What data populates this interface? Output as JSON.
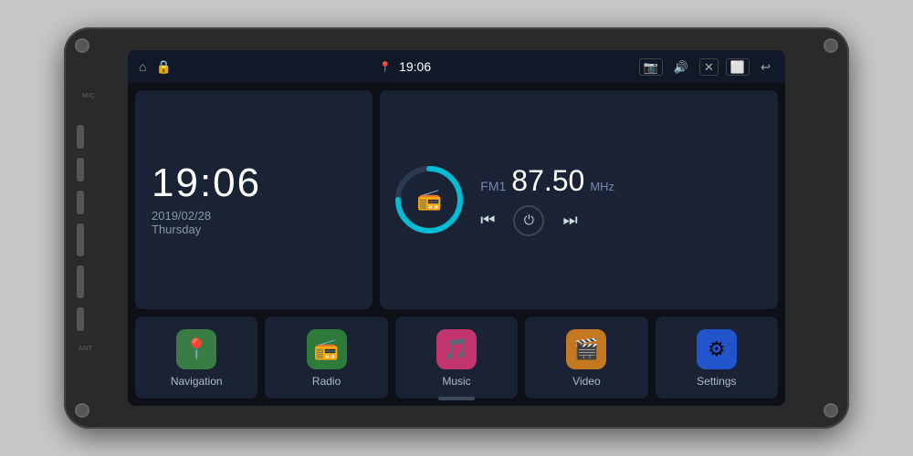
{
  "unit": {
    "background_color": "#2a2a2a"
  },
  "status_bar": {
    "time": "19:06",
    "location_icon": "📍",
    "home_icon": "⌂",
    "lock_icon": "🔒",
    "camera_icon": "📷",
    "volume_icon": "🔊",
    "mute_icon": "✕",
    "window_icon": "⬜",
    "back_icon": "↩"
  },
  "clock": {
    "time": "19:06",
    "date": "2019/02/28",
    "day": "Thursday"
  },
  "radio": {
    "band": "FM1",
    "frequency": "87.50",
    "unit": "MHz",
    "arc_color": "#00bcd4",
    "arc_bg_color": "#2a3a50"
  },
  "apps": [
    {
      "id": "navigation",
      "label": "Navigation",
      "icon": "📍",
      "icon_color_class": "icon-green"
    },
    {
      "id": "radio",
      "label": "Radio",
      "icon": "📻",
      "icon_color_class": "icon-green2"
    },
    {
      "id": "music",
      "label": "Music",
      "icon": "🎵",
      "icon_color_class": "icon-pink"
    },
    {
      "id": "video",
      "label": "Video",
      "icon": "🎬",
      "icon_color_class": "icon-orange"
    },
    {
      "id": "settings",
      "label": "Settings",
      "icon": "⚙",
      "icon_color_class": "icon-blue"
    }
  ],
  "side_buttons": {
    "power_label": "⏻",
    "home_label": "⌂",
    "back_label": "↩",
    "vol_up_label": "+",
    "vol_down_label": "-",
    "mic_label": "MIC",
    "ant_label": "ANT"
  }
}
